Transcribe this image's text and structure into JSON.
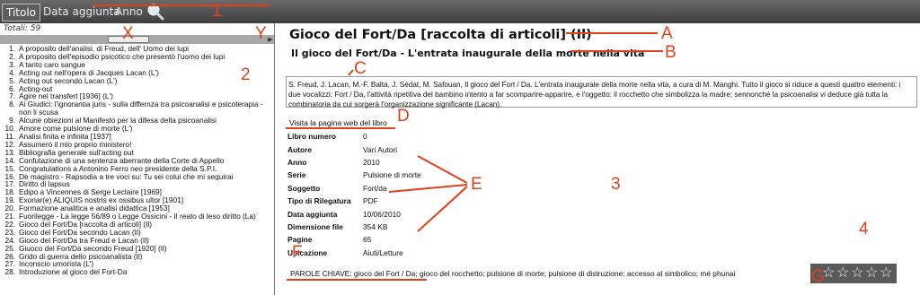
{
  "toolbar": {
    "tabs": [
      "Titolo",
      "Data aggiunta",
      "Anno"
    ],
    "search_icon": "search-icon"
  },
  "left_panel": {
    "totals": "Totali: 59",
    "items": [
      {
        "num": "1.",
        "text": "A proposito dell'analisi, di Freud, dell' Uomo dei lupi"
      },
      {
        "num": "2.",
        "text": "A proposito dell'episodio psicotico che presentò l'uomo dei lupi"
      },
      {
        "num": "3.",
        "text": "A tanto caro sangue"
      },
      {
        "num": "4.",
        "text": "Acting out nell'opera di Jacques Lacan (L')"
      },
      {
        "num": "5.",
        "text": "Acting out secondo Lacan (L')"
      },
      {
        "num": "6.",
        "text": "Acting-out"
      },
      {
        "num": "7.",
        "text": "Agire nel transfert [1936] (L')"
      },
      {
        "num": "8.",
        "text": "Ai Giudici: l'ignorantia juris - sulla differnza tra psicoanalisi e psicoterapia -",
        "cont": "non li scusa"
      },
      {
        "num": "9.",
        "text": "Alcune obiezioni al Manifesto per la difesa della psicoanalisi"
      },
      {
        "num": "10.",
        "text": "Amore come pulsione di morte (L')"
      },
      {
        "num": "11.",
        "text": "Analisi finita e infinita [1937]"
      },
      {
        "num": "12.",
        "text": "Assumerò il mio proprio ministero!"
      },
      {
        "num": "13.",
        "text": "Bibliografia generale sull'acting out"
      },
      {
        "num": "14.",
        "text": "Confutazione di una sentenza aberrante della Corte di Appello"
      },
      {
        "num": "15.",
        "text": "Congratulations a Antonino Ferro neo presidente della S.P.I."
      },
      {
        "num": "16.",
        "text": "De magistro - Rapsodia a tre voci su: Tu sei colui che mi seguirai"
      },
      {
        "num": "17.",
        "text": "Diritto di lapsus"
      },
      {
        "num": "18.",
        "text": "Edipo a Vincennes di Serge Leclaire [1969]"
      },
      {
        "num": "19.",
        "text": "Exoriar(e) ALIQUIS nostris ex ossibus ultor [1901]"
      },
      {
        "num": "20.",
        "text": "Formazione analitica e analisi didattica [1953]"
      },
      {
        "num": "21.",
        "text": "Fuorilegge - La legge 56/89 o Legge Ossicini - Il reato di leso diritto (La)"
      },
      {
        "num": "22.",
        "text": "Gioco del Fort/Da [raccolta di articoli] (Il)"
      },
      {
        "num": "23.",
        "text": "Gioco del Fort/Da secondo Lacan (Il)"
      },
      {
        "num": "24.",
        "text": "Gioco del Fort/Da tra Freud e Lacan (Il)"
      },
      {
        "num": "25.",
        "text": "Giuoco del Fort/Da secondo Freud [1920] (Il)"
      },
      {
        "num": "26.",
        "text": "Grido di guerra dello psicoanalista (Il)"
      },
      {
        "num": "27.",
        "text": "Inconscio umorista (L')"
      },
      {
        "num": "28.",
        "text": "Introduzione al gioco del Fort-Da"
      }
    ]
  },
  "detail": {
    "title": "Gioco del Fort/Da [raccolta di articoli] (Il)",
    "subtitle": "Il gioco del Fort/Da - L'entrata inaugurale della morte nella vita",
    "description": "S. Freud, J. Lacan, M.-F. Balta, J. Sédat, M. Safouan, Il gioco del Fort / Da. L'entrata inaugurale della morte nella vita, a cura di M. Manghi. Tutto il gioco si riduce a questi quattro elementi: i due vocalizzi: Fort / Da, l'attività ripetitiva del bambino intento a far scomparire-apparire, e l'oggetto: il rocchetto che simbolizza la madre; sennonché la psicoanalisi vi deduce già tutta la combinatoria da cui sorgerà l'organizzazione significante (Lacan).",
    "web_link": "Visita la pagina web del libro",
    "fields": [
      {
        "label": "Libro numero",
        "value": "0"
      },
      {
        "label": "Autore",
        "value": "Vari Autori"
      },
      {
        "label": "Anno",
        "value": "2010"
      },
      {
        "label": "Serie",
        "value": "Pulsione di morte"
      },
      {
        "label": "Soggetto",
        "value": "Fort/da"
      },
      {
        "label": "Tipo di Rilegatura",
        "value": "PDF"
      },
      {
        "label": "Data aggiunta",
        "value": "10/06/2010"
      },
      {
        "label": "Dimensione file",
        "value": "354 KB"
      },
      {
        "label": "Pagine",
        "value": "65"
      },
      {
        "label": "Ubicazione",
        "value": "Aiuti/Letture"
      }
    ],
    "keywords": "PAROLE CHIAVE: gioco del Fort / Da; gioco del rocchetto; pulsione di morte; pulsione di distruzione; accesso al simbolico; mé phunai",
    "rating": {
      "stars": 5,
      "filled": 0
    }
  },
  "annotations": {
    "n1": "1",
    "n2": "2",
    "n3": "3",
    "n4": "4",
    "X": "X",
    "Y": "Y",
    "A": "A",
    "B": "B",
    "C": "C",
    "D": "D",
    "E": "E",
    "F": "F",
    "G": "G"
  },
  "colors": {
    "annotation": "#e2401a",
    "toolbar": "#4a4a4a",
    "rating_bg": "#5a5a5a"
  }
}
